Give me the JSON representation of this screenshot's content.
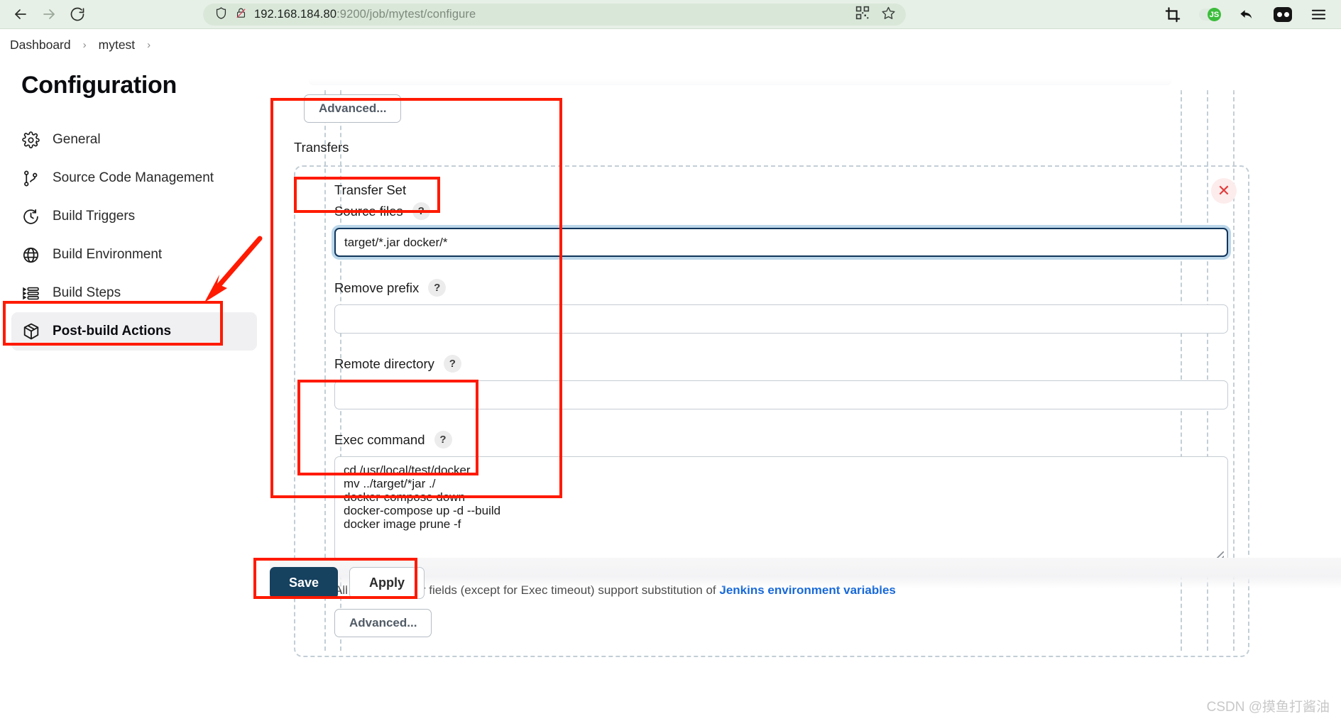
{
  "browser": {
    "back_icon": "arrow-left-icon",
    "forward_icon": "arrow-right-icon",
    "reload_icon": "reload-icon",
    "shield_icon": "shield-icon",
    "insecure_icon": "insecure-lock-icon",
    "url_host": "192.168.184.80",
    "url_rest": ":9200/job/mytest/configure",
    "qr_icon": "qr-code-icon",
    "bookmark_icon": "star-icon",
    "crop_icon": "crop-icon",
    "js_toggle_label": "JS",
    "undo_icon": "undo-arrow-icon",
    "profile_icon": "profile-chip-icon",
    "menu_icon": "hamburger-menu-icon"
  },
  "breadcrumb": {
    "items": [
      "Dashboard",
      "mytest"
    ],
    "separator": "›"
  },
  "job_select": {
    "value": "mytest",
    "chevron": "⌄"
  },
  "sidebar": {
    "title": "Configuration",
    "items": [
      {
        "label": "General",
        "icon": "gear-icon",
        "active": false
      },
      {
        "label": "Source Code Management",
        "icon": "git-branch-icon",
        "active": false
      },
      {
        "label": "Build Triggers",
        "icon": "clock-icon",
        "active": false
      },
      {
        "label": "Build Environment",
        "icon": "globe-icon",
        "active": false
      },
      {
        "label": "Build Steps",
        "icon": "list-steps-icon",
        "active": false
      },
      {
        "label": "Post-build Actions",
        "icon": "package-box-icon",
        "active": true
      }
    ]
  },
  "form": {
    "advanced_top_label": "Advanced...",
    "transfers_label": "Transfers",
    "transfer_set_label": "Transfer Set",
    "close_icon": "close-x-icon",
    "fields": [
      {
        "label": "Source files",
        "help": "?",
        "value": "target/*.jar docker/*",
        "placeholder": "",
        "focused": true,
        "type": "text"
      },
      {
        "label": "Remove prefix",
        "help": "?",
        "value": "",
        "placeholder": "",
        "focused": false,
        "type": "text"
      },
      {
        "label": "Remote directory",
        "help": "?",
        "value": "",
        "placeholder": "",
        "focused": false,
        "type": "text"
      },
      {
        "label": "Exec command",
        "help": "?",
        "value": "cd /usr/local/test/docker\nmv ../target/*jar ./\ndocker-compose down\ndocker-compose up -d --build\ndocker image prune -f",
        "placeholder": "",
        "focused": false,
        "type": "textarea"
      }
    ],
    "note_text": "All of the transfer fields (except for Exec timeout) support substitution of ",
    "note_link": "Jenkins environment variables",
    "advanced_bottom_label": "Advanced..."
  },
  "footer": {
    "save_label": "Save",
    "apply_label": "Apply"
  },
  "watermark": "CSDN @摸鱼打酱油",
  "colors": {
    "accent_blue": "#1668d9",
    "save_navy": "#16415f",
    "annotation_red": "#ff1a00",
    "focus_ring": "#bcd7ea"
  }
}
